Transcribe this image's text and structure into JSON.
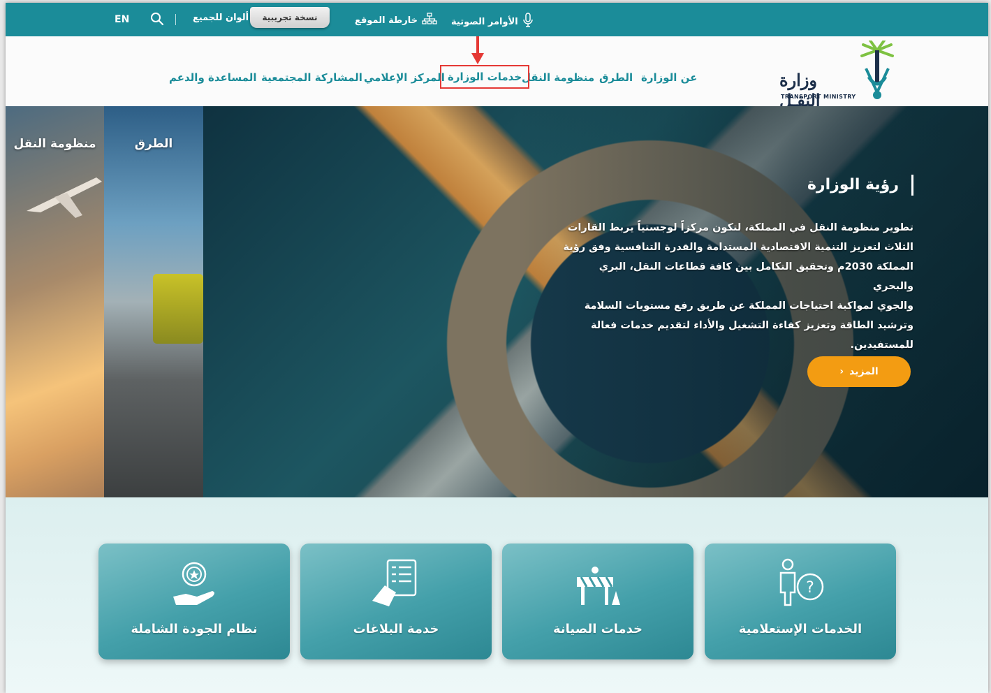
{
  "topbar": {
    "lang": "EN",
    "colors_for_all": "ألوان للجميع",
    "beta_badge": "نسخة تجريبية",
    "sitemap": "خارطة الموقع",
    "voice_commands": "الأوامر الصوتية"
  },
  "nav": {
    "items": [
      {
        "label": "عن الوزارة"
      },
      {
        "label": "الطرق"
      },
      {
        "label": "منظومة النقل"
      },
      {
        "label": "خدمات الوزارة"
      },
      {
        "label": "المركز الإعلامي"
      },
      {
        "label": "المشاركة المجتمعية"
      },
      {
        "label": "المساعدة والدعم"
      }
    ],
    "highlighted": "خدمات الوزارة"
  },
  "logo": {
    "name_ar": "وزارة النقـل",
    "name_en": "TRANSPORT MINISTRY"
  },
  "hero": {
    "side_panels": [
      "منظومة النقل",
      "الطرق"
    ],
    "vision_title": "رؤية الوزارة",
    "vision_lines": [
      "تطوير منظومة النقل في المملكة، لتكون مركزاً لوجستياً يربط القارات",
      "الثلاث لتعزيز التنمية الاقتصادية المستدامة والقدرة التنافسية وفق رؤية",
      "المملكة 2030م وتحقيق التكامل بين كافة قطاعات النقل، البري والبحري",
      "والجوي لمواكبة احتياجات المملكة عن طريق رفع مستويات السلامة",
      "وترشيد الطاقة وتعزيز كفاءة التشغيل والأداء لتقديم خدمات فعالة",
      "للمستفيدين."
    ],
    "more_button": "المزيد"
  },
  "cards": [
    {
      "label": "نظام الجودة الشاملة",
      "icon": "quality-award-icon"
    },
    {
      "label": "خدمة البلاغات",
      "icon": "report-document-icon"
    },
    {
      "label": "خدمات الصيانة",
      "icon": "maintenance-barrier-icon"
    },
    {
      "label": "الخدمات الإستعلامية",
      "icon": "inquiry-person-icon"
    }
  ],
  "colors": {
    "primary_teal": "#1b8c99",
    "accent_orange": "#f39c12",
    "highlight_red": "#e53935"
  }
}
